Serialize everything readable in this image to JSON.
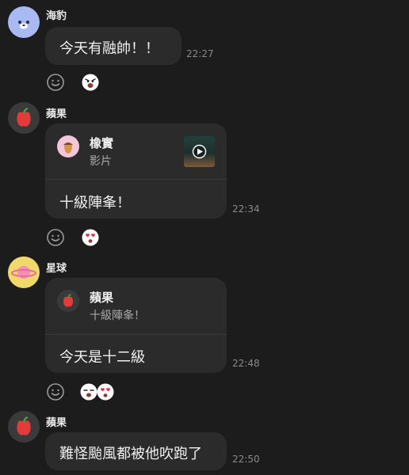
{
  "colors": {
    "background": "#1c1c1c",
    "bubble": "#2b2b2b",
    "muted_text": "#8a8a8a",
    "divider": "#3a3a3a"
  },
  "messages": [
    {
      "sender": "海豹",
      "avatar_icon": "seal-avatar-icon",
      "text": "今天有融帥！！",
      "time": "22:27",
      "reaction_icon": "surprised-face-sticker-icon"
    },
    {
      "sender": "蘋果",
      "avatar_icon": "apple-avatar-icon",
      "reply": {
        "author": "橡實",
        "label": "影片",
        "author_icon": "acorn-avatar-icon",
        "thumb_icon": "video-play-icon"
      },
      "text": "十級陣夆！",
      "time": "22:34",
      "reaction_icon": "heart-eyes-sticker-icon"
    },
    {
      "sender": "星球",
      "avatar_icon": "planet-avatar-icon",
      "reply": {
        "author": "蘋果",
        "label": "十級陣夆！",
        "author_icon": "apple-avatar-icon"
      },
      "text": "今天是十二級",
      "time": "22:48",
      "reaction_icon": "sticker-pair-icon"
    },
    {
      "sender": "蘋果",
      "avatar_icon": "apple-avatar-icon",
      "text": "難怪颱風都被他吹跑了",
      "time": "22:50"
    }
  ]
}
